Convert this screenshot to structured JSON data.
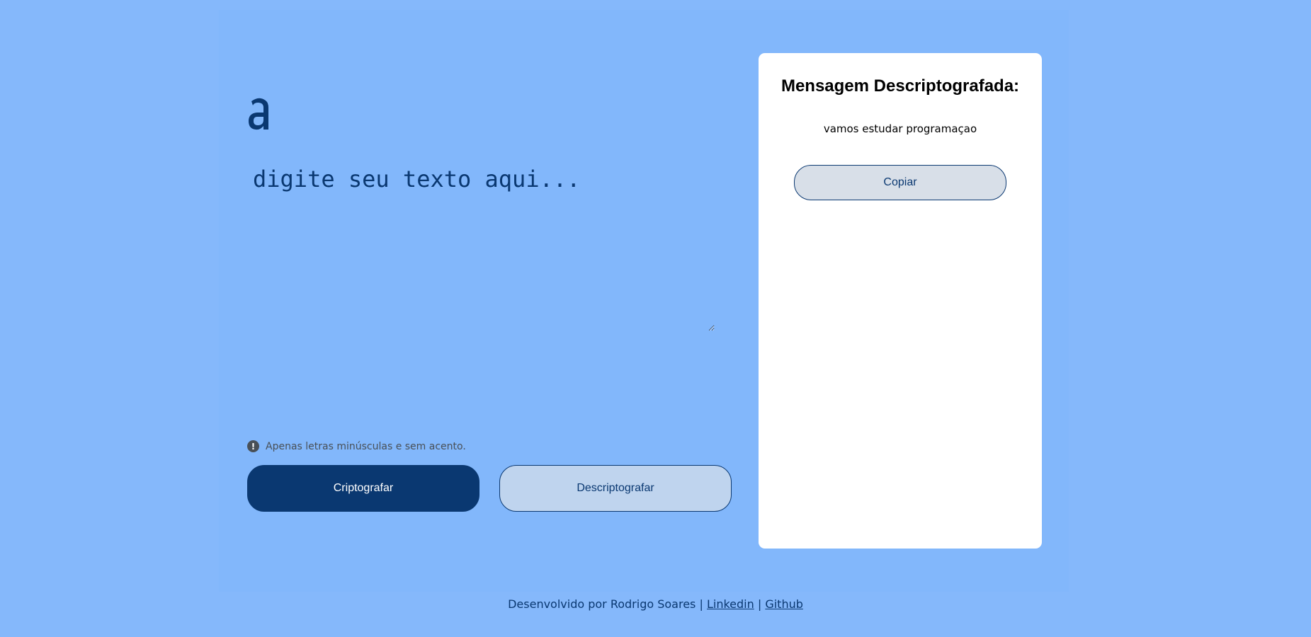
{
  "input": {
    "placeholder": "digite seu texto aqui..."
  },
  "hint": {
    "icon": "exclamation-icon",
    "text": "Apenas letras minúsculas e sem acento."
  },
  "buttons": {
    "encrypt_label": "Criptografar",
    "decrypt_label": "Descriptografar"
  },
  "result": {
    "title": "Mensagem Descriptografada:",
    "text": "vamos estudar programaçao",
    "copy_label": "Copiar"
  },
  "footer": {
    "credit": "Desenvolvido por Rodrigo Soares",
    "separator": "|",
    "linkedin_label": "Linkedin",
    "github_label": "Github"
  },
  "colors": {
    "background": "#85b8fb",
    "accent": "#0a3871",
    "card": "#ffffff"
  }
}
